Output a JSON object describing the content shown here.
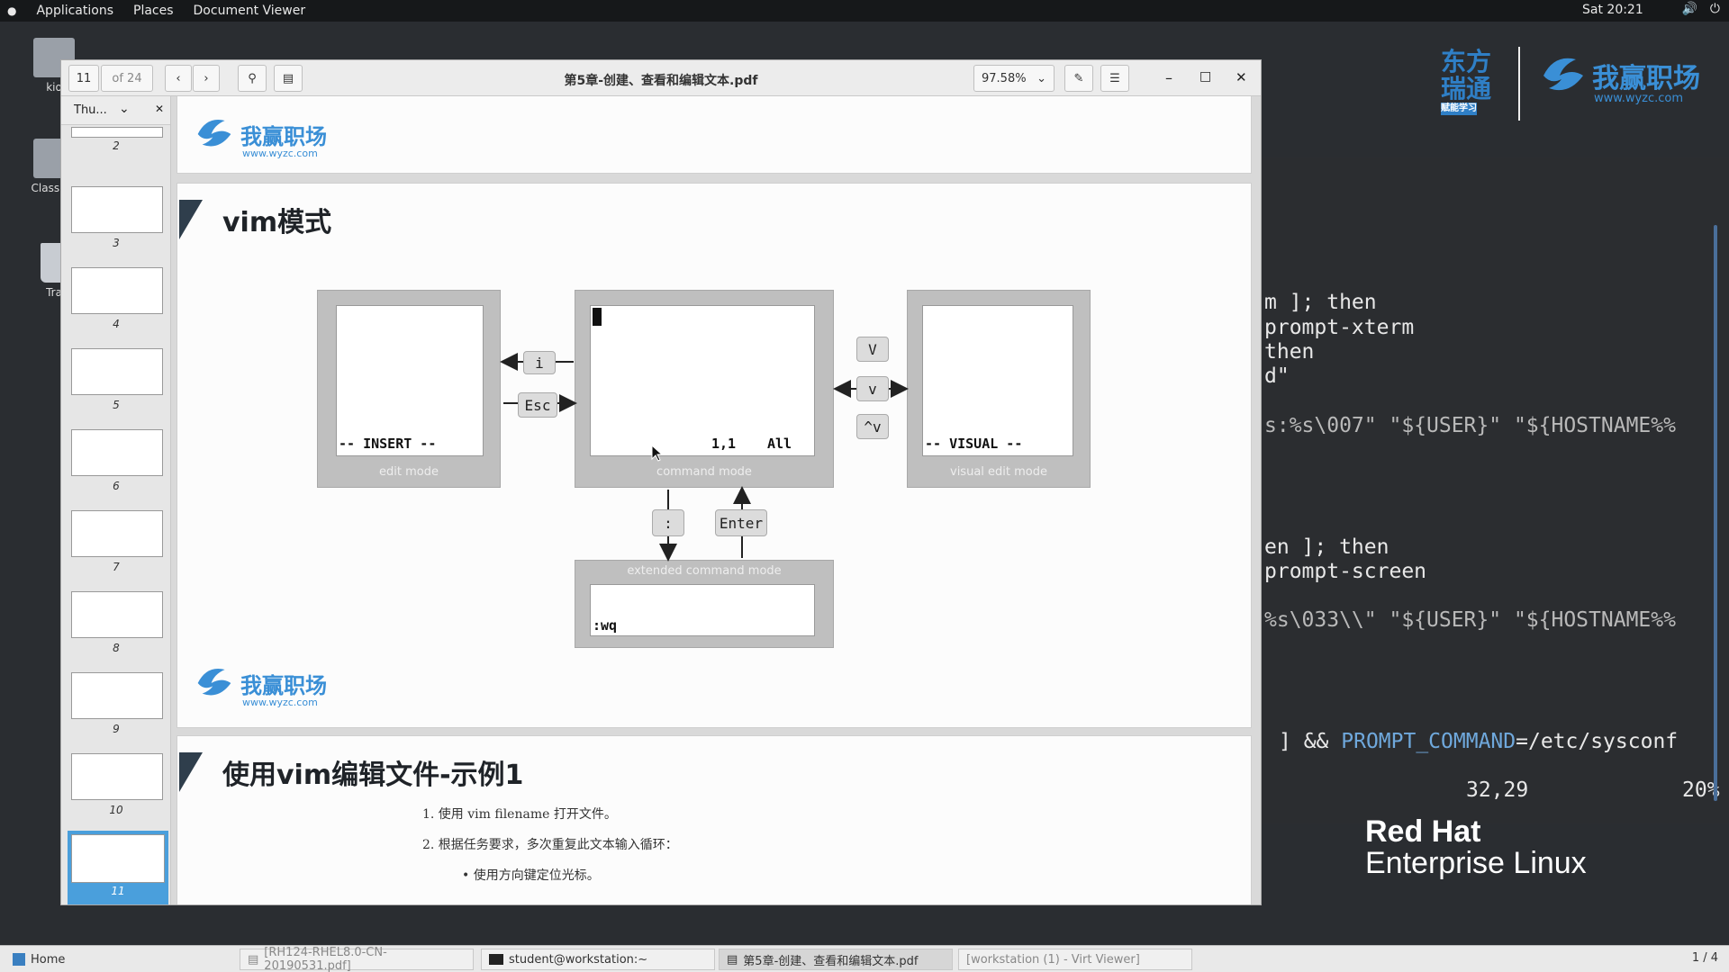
{
  "topbar": {
    "menu": [
      "Applications",
      "Places",
      "Document Viewer"
    ],
    "clock": "Sat 20:21"
  },
  "desktop": {
    "icons": [
      "kio",
      "Classroo",
      "Tra"
    ]
  },
  "terminal": {
    "lines": [
      "m ]; then",
      "prompt-xterm",
      "then",
      "d\"",
      "s:%s\\007\" \"${USER}\" \"${HOSTNAME%%",
      "en ]; then",
      "prompt-screen",
      "%s\\033\\\\\" \"${USER}\" \"${HOSTNAME%%",
      "] && ",
      "PROMPT_COMMAND",
      "=/etc/sysconf",
      "32,29",
      "20%"
    ]
  },
  "logos": {
    "dfrt_line1": "东方",
    "dfrt_line2": "瑞通",
    "dfrt_line3": "赋能学习",
    "wyzc_name": "我赢职场",
    "wyzc_url": "www.wyzc.com",
    "redhat_line1": "Red Hat",
    "redhat_line2": "Enterprise Linux"
  },
  "viewer": {
    "page_current": "11",
    "page_total": "of 24",
    "title": "第5章-创建、查看和编辑文本.pdf",
    "zoom": "97.58%",
    "sidebar_mode": "Thu...",
    "thumbnails": [
      "2",
      "3",
      "4",
      "5",
      "6",
      "7",
      "8",
      "9",
      "10",
      "11"
    ]
  },
  "slide1": {
    "title": "vim模式",
    "insert_status": "-- INSERT --",
    "insert_label": "edit mode",
    "command_pos": "1,1",
    "command_all": "All",
    "command_label": "command mode",
    "visual_status": "-- VISUAL --",
    "visual_label": "visual edit mode",
    "extended_label": "extended command mode",
    "extended_cmd": ":wq",
    "key_i": "i",
    "key_esc": "Esc",
    "key_V": "V",
    "key_v": "v",
    "key_ctrl_v": "^v",
    "key_colon": ":",
    "key_enter": "Enter"
  },
  "slide2": {
    "title": "使用vim编辑文件-示例1",
    "lines": [
      "1.    使用 vim filename 打开文件。",
      "2.    根据任务要求，多次重复此文本输入循环：",
      "• 使用方向键定位光标。"
    ]
  },
  "taskbar": {
    "home": "Home",
    "tasks": [
      "[RH124-RHEL8.0-CN-20190531.pdf]",
      "student@workstation:~",
      "第5章-创建、查看和编辑文本.pdf",
      "[workstation (1) - Virt Viewer]"
    ],
    "pager": "1 / 4"
  }
}
